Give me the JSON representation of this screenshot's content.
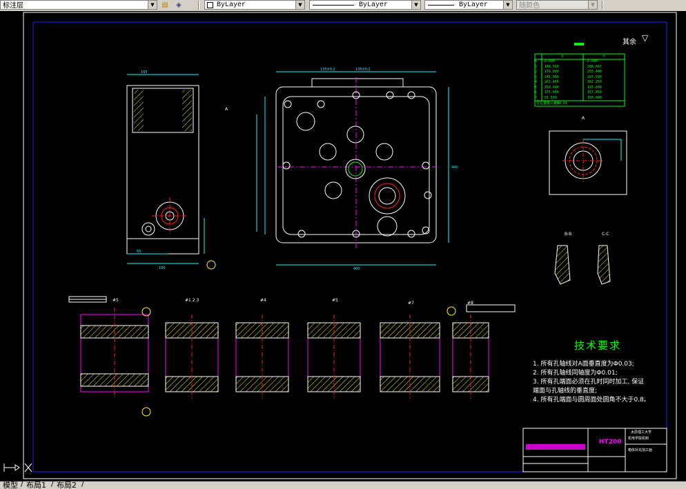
{
  "toolbar": {
    "layer_combo": "标注层",
    "color_combo": "ByLayer",
    "linetype_combo": "ByLayer",
    "lineweight_combo": "ByLayer",
    "plotstyle_combo": "随颜色"
  },
  "drawing": {
    "surface_note": "其余",
    "title_block_code": "HT200",
    "title_block_school_1": "太原理工大学",
    "title_block_school_2": "机电学院机制",
    "title_block_part_name": "箱体补充加工面",
    "tech_title": "技术要求",
    "tech_notes": [
      "1. 所有孔轴线对A面垂直度为Φ0.03;",
      "2. 所有孔轴线同轴度为Φ0.01;",
      "3. 所有孔端面必须在孔时同时加工, 保证",
      "端面与孔轴线的垂直度;",
      "4. 所有孔端面与圆周面处圆角不大于0.8。"
    ],
    "section_labels": [
      "#5",
      "#1 2 3",
      "#4",
      "#5",
      "#7",
      "#8"
    ],
    "view_a_label": "A",
    "view_bb_label": "B-B",
    "view_cc_label": "C-C",
    "coord_table": {
      "headers": [
        "",
        "X",
        "Y"
      ],
      "rows": [
        [
          "0",
          "0.000",
          "0.000"
        ],
        [
          "1",
          "168.500",
          "208.667"
        ],
        [
          "2",
          "170.000",
          "255.400"
        ],
        [
          "3",
          "245.000",
          "207.500"
        ],
        [
          "4",
          "263.450",
          "162.250"
        ],
        [
          "5",
          "350.000",
          "195.030"
        ],
        [
          "6",
          "175.000",
          "157.850"
        ],
        [
          "7",
          "93.500",
          "150.000"
        ]
      ],
      "footer": "孔位置度公差Φ0.01"
    }
  },
  "tabs": {
    "model": "模型",
    "layout1": "布局1",
    "layout2": "布局2"
  },
  "colors": {
    "frame_blue": "#2020ff",
    "cyan": "#00ffff",
    "yellow": "#ffff00",
    "green": "#00ff00",
    "red": "#ff2020",
    "magenta": "#ff00ff",
    "white": "#ffffff"
  }
}
